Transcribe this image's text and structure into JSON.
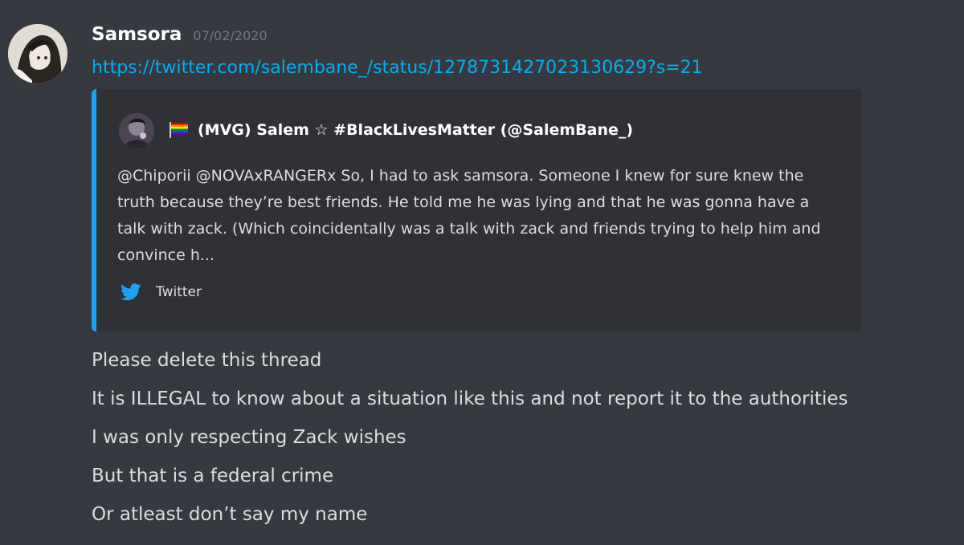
{
  "message": {
    "author": "Samsora",
    "timestamp": "07/02/2020",
    "link": "https://twitter.com/salembane_/status/1278731427023130629?s=21",
    "embed": {
      "author_name": "(MVG) Salem ☆ #BlackLivesMatter (@SalemBane_)",
      "description": "@Chiporii @NOVAxRANGERx So, I had to ask samsora. Someone I knew for sure knew the truth because they’re best friends. He told me he was lying and that he was gonna have a talk with zack. (Which coincidentally was a talk with zack and friends trying to help him and convince h...",
      "footer": "Twitter",
      "accent_color": "#1da1f2"
    },
    "lines": [
      "Please delete this thread",
      "It is ILLEGAL to know about a situation like this and not report it to the authorities",
      "I was only respecting Zack wishes",
      "But that is a federal crime",
      "Or atleast don’t say my name"
    ]
  },
  "colors": {
    "background": "#36393f",
    "embed_background": "#2f3136",
    "link": "#00b0f4",
    "timestamp": "#72767d",
    "text": "#dcddde"
  },
  "icons": {
    "embed_flag": "rainbow-flag-icon",
    "embed_footer": "twitter-bird-icon"
  }
}
